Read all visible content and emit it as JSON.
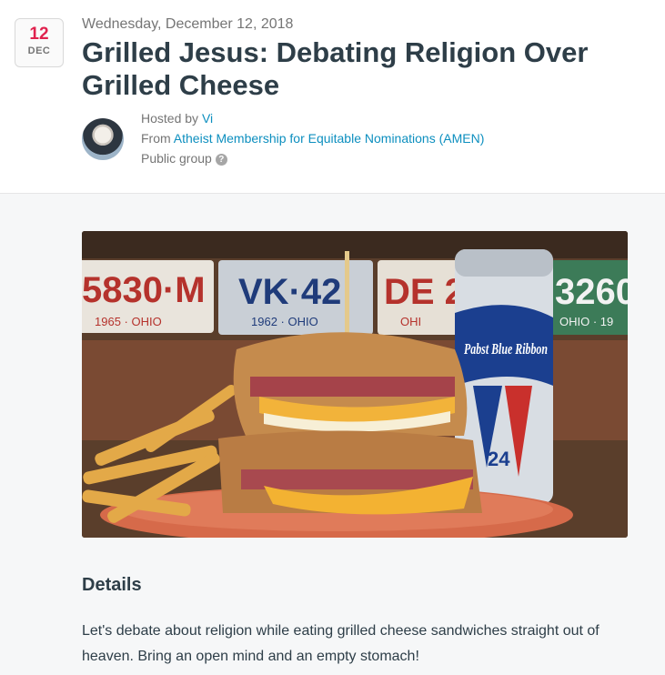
{
  "event": {
    "date_badge": {
      "day": "12",
      "month": "DEC"
    },
    "date_line": "Wednesday, December 12, 2018",
    "title": "Grilled Jesus: Debating Religion Over Grilled Cheese",
    "hosted_by_prefix": "Hosted by ",
    "host_name": "Vi",
    "from_prefix": "From ",
    "group_name": "Atheist Membership for Equitable Nominations (AMEN)",
    "privacy": "Public group",
    "help_glyph": "?"
  },
  "photo": {
    "plates": [
      "5830·M",
      "1965 · OHIO",
      "VK·42",
      "1962 · OHIO",
      "DE 2",
      "OHI",
      "3260",
      "OHIO · 19"
    ],
    "can_text": "Pabst Blue Ribbon",
    "can_number": "24"
  },
  "details": {
    "heading": "Details",
    "body": "Let's debate about religion while eating grilled cheese sandwiches straight out of heaven. Bring an open mind and an empty stomach!"
  },
  "colors": {
    "accent": "#e0224e",
    "link": "#0d8fbf",
    "text": "#2e3e48",
    "muted": "#757575"
  }
}
